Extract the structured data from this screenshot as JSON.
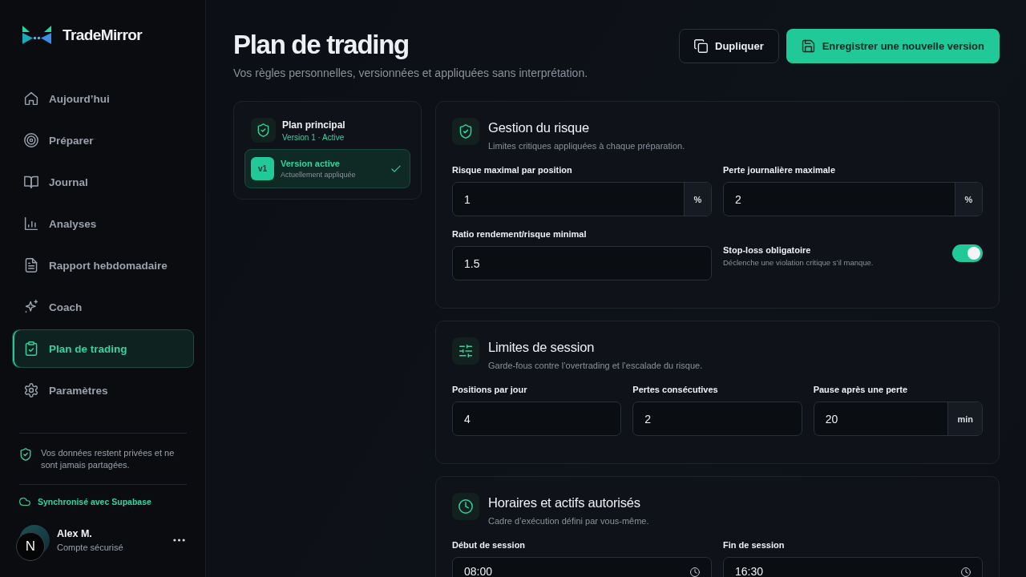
{
  "sidebar": {
    "brand": "TradeMirror",
    "nav": [
      {
        "label": "Aujourd’hui",
        "selected": false
      },
      {
        "label": "Préparer",
        "selected": false
      },
      {
        "label": "Journal",
        "selected": false
      },
      {
        "label": "Analyses",
        "selected": false
      },
      {
        "label": "Rapport hebdomadaire",
        "selected": false
      },
      {
        "label": "Coach",
        "selected": false
      },
      {
        "label": "Plan de trading",
        "selected": true
      },
      {
        "label": "Paramètres",
        "selected": false
      }
    ],
    "privacy_note": "Vos données restent privées et ne sont jamais partagées.",
    "sync_status": "Synchronisé avec Supabase",
    "user": {
      "name": "Alex M.",
      "status": "Compte sécurisé"
    }
  },
  "dev_tools_button": {
    "label": "N"
  },
  "header": {
    "title": "Plan de trading",
    "subtitle": "Vos règles personnelles, versionnées et appliquées sans interprétation.",
    "actions": [
      {
        "label": "Dupliquer",
        "kind": "secondary"
      },
      {
        "label": "Enregistrer une nouvelle version",
        "kind": "primary"
      }
    ]
  },
  "plan": {
    "name": "Plan principal",
    "status": "Version 1 · Active",
    "versions": [
      {
        "badge": "v1",
        "title": "Version active",
        "subtitle": "Actuellement appliquée",
        "selected": true
      }
    ]
  },
  "sections": [
    {
      "title": "Gestion du risque",
      "subtitle": "Limites critiques appliquées à chaque préparation.",
      "rows": [
        [
          {
            "kind": "number",
            "label": "Risque maximal par position",
            "value": "1",
            "suffix": "%"
          },
          {
            "kind": "number",
            "label": "Perte journalière maximale",
            "value": "2",
            "suffix": "%"
          }
        ],
        [
          {
            "kind": "number",
            "label": "Ratio rendement/risque minimal",
            "value": "1.5"
          },
          {
            "kind": "toggle",
            "label": "Stop-loss obligatoire",
            "description": "Déclenche une violation critique s’il manque.",
            "on": true
          }
        ]
      ]
    },
    {
      "title": "Limites de session",
      "subtitle": "Garde-fous contre l’overtrading et l’escalade du risque.",
      "rows": [
        [
          {
            "kind": "number",
            "label": "Positions par jour",
            "value": "4"
          },
          {
            "kind": "number",
            "label": "Pertes consécutives",
            "value": "2"
          },
          {
            "kind": "number",
            "label": "Pause après une perte",
            "value": "20",
            "suffix": "min"
          }
        ]
      ]
    },
    {
      "title": "Horaires et actifs autorisés",
      "subtitle": "Cadre d’exécution défini par vous-même.",
      "rows": [
        [
          {
            "kind": "time",
            "label": "Début de session",
            "value": "08:00"
          },
          {
            "kind": "time",
            "label": "Fin de session",
            "value": "16:30"
          }
        ]
      ]
    }
  ]
}
